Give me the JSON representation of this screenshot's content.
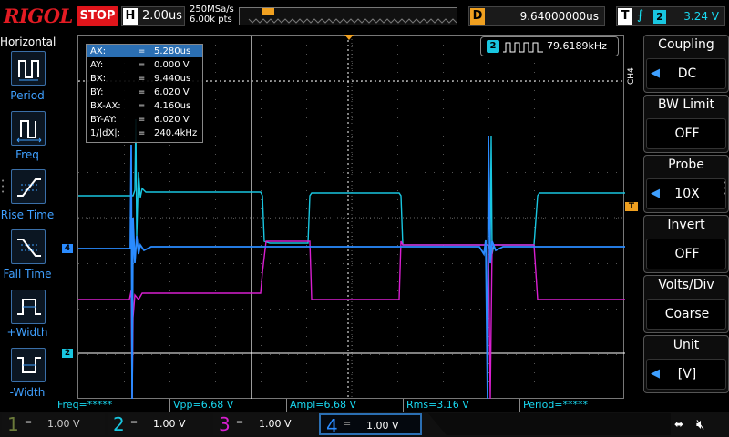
{
  "header": {
    "brand": "RIGOL",
    "run_state": "STOP",
    "timebase_tag": "H",
    "timebase": "2.00us",
    "sample_rate": "250MSa/s",
    "memory_depth": "6.00k pts",
    "delay_tag": "D",
    "delay": "9.64000000us",
    "trigger_tag": "T",
    "trigger_edge": "rising",
    "trigger_source": "2",
    "trigger_level": "3.24 V"
  },
  "left_menu": {
    "title": "Horizontal",
    "items": [
      {
        "label": "Period",
        "icon": "period-icon"
      },
      {
        "label": "Freq",
        "icon": "freq-icon"
      },
      {
        "label": "Rise Time",
        "icon": "rise-time-icon"
      },
      {
        "label": "Fall Time",
        "icon": "fall-time-icon"
      },
      {
        "label": "+Width",
        "icon": "pos-width-icon"
      },
      {
        "label": "-Width",
        "icon": "neg-width-icon"
      }
    ]
  },
  "cursors": {
    "rows": [
      {
        "k": "AX:",
        "v": "5.280us"
      },
      {
        "k": "AY:",
        "v": "0.000 V"
      },
      {
        "k": "BX:",
        "v": "9.440us"
      },
      {
        "k": "BY:",
        "v": "6.020 V"
      },
      {
        "k": "BX-AX:",
        "v": "4.160us"
      },
      {
        "k": "BY-AY:",
        "v": "6.020 V"
      },
      {
        "k": "1/|dX|:",
        "v": "240.4kHz"
      }
    ]
  },
  "freq_counter": {
    "source": "2",
    "value": "79.6189kHz"
  },
  "marker_labels": {
    "ch4": "4",
    "ch2": "2",
    "trig": "T"
  },
  "right_menu": {
    "channel_tab": "CH4",
    "items": [
      {
        "title": "Coupling",
        "value": "DC"
      },
      {
        "title": "BW Limit",
        "value": "OFF"
      },
      {
        "title": "Probe",
        "value": "10X"
      },
      {
        "title": "Invert",
        "value": "OFF"
      },
      {
        "title": "Volts/Div",
        "value": "Coarse"
      },
      {
        "title": "Unit",
        "value": "[V]"
      }
    ]
  },
  "measurements": [
    "Freq=*****",
    "Vpp=6.68 V",
    "Ampl=6.68 V",
    "Rms=3.16 V",
    "Period=*****"
  ],
  "channels": [
    {
      "num": "1",
      "scale": "1.00 V",
      "color": "#6b7a3a"
    },
    {
      "num": "2",
      "scale": "1.00 V",
      "color": "#19c6e0"
    },
    {
      "num": "3",
      "scale": "1.00 V",
      "color": "#d81fd0"
    },
    {
      "num": "4",
      "scale": "1.00 V",
      "color": "#2a8bff"
    }
  ],
  "colors": {
    "ch1": "#6b7a3a",
    "ch2": "#19c6e0",
    "ch3": "#d81fd0",
    "ch4": "#2a8bff",
    "accent": "#2b6fb3",
    "cursor": "#f0a020"
  }
}
